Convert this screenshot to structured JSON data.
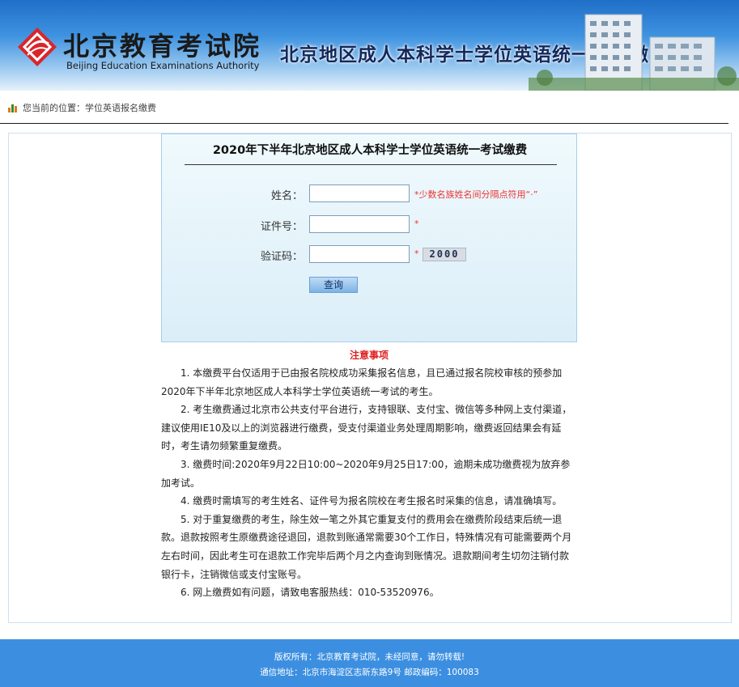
{
  "header": {
    "logo_cn": "北京教育考试院",
    "logo_en": "Beijing Education Examinations Authority",
    "title": "北京地区成人本科学士学位英语统一考试缴费"
  },
  "breadcrumb": {
    "text": "您当前的位置：学位英语报名缴费"
  },
  "form": {
    "title": "2020年下半年北京地区成人本科学士学位英语统一考试缴费",
    "name_label": "姓名：",
    "name_value": "",
    "name_note": "*少数名族姓名间分隔点符用“·”",
    "id_label": "证件号：",
    "id_value": "",
    "id_note": "*",
    "captcha_label": "验证码：",
    "captcha_value": "",
    "captcha_note": "*",
    "captcha_image_text": "2000",
    "query_button": "查询"
  },
  "notice": {
    "title": "注意事项",
    "items": [
      "1. 本缴费平台仅适用于已由报名院校成功采集报名信息，且已通过报名院校审核的预参加2020年下半年北京地区成人本科学士学位英语统一考试的考生。",
      "2. 考生缴费通过北京市公共支付平台进行，支持银联、支付宝、微信等多种网上支付渠道，建议使用IE10及以上的浏览器进行缴费，受支付渠道业务处理周期影响，缴费返回结果会有延时，考生请勿频繁重复缴费。",
      "3. 缴费时间:2020年9月22日10:00~2020年9月25日17:00，逾期未成功缴费视为放弃参加考试。",
      "4. 缴费时需填写的考生姓名、证件号为报名院校在考生报名时采集的信息，请准确填写。",
      "5. 对于重复缴费的考生，除生效一笔之外其它重复支付的费用会在缴费阶段结束后统一退款。退款按照考生原缴费途径退回，退款到账通常需要30个工作日，特殊情况有可能需要两个月左右时间，因此考生可在退款工作完毕后两个月之内查询到账情况。退款期间考生切勿注销付款银行卡，注销微信或支付宝账号。",
      "6. 网上缴费如有问题，请致电客服热线：010-53520976。"
    ]
  },
  "footer": {
    "line1": "版权所有：北京教育考试院，未经同意，请勿转载!",
    "line2": "通信地址：北京市海淀区志新东路9号 邮政编码：100083"
  },
  "colors": {
    "header_blue": "#3f93e0",
    "footer_blue": "#3c8fe0",
    "accent_red": "#e02020",
    "logo_red": "#d9262b"
  }
}
